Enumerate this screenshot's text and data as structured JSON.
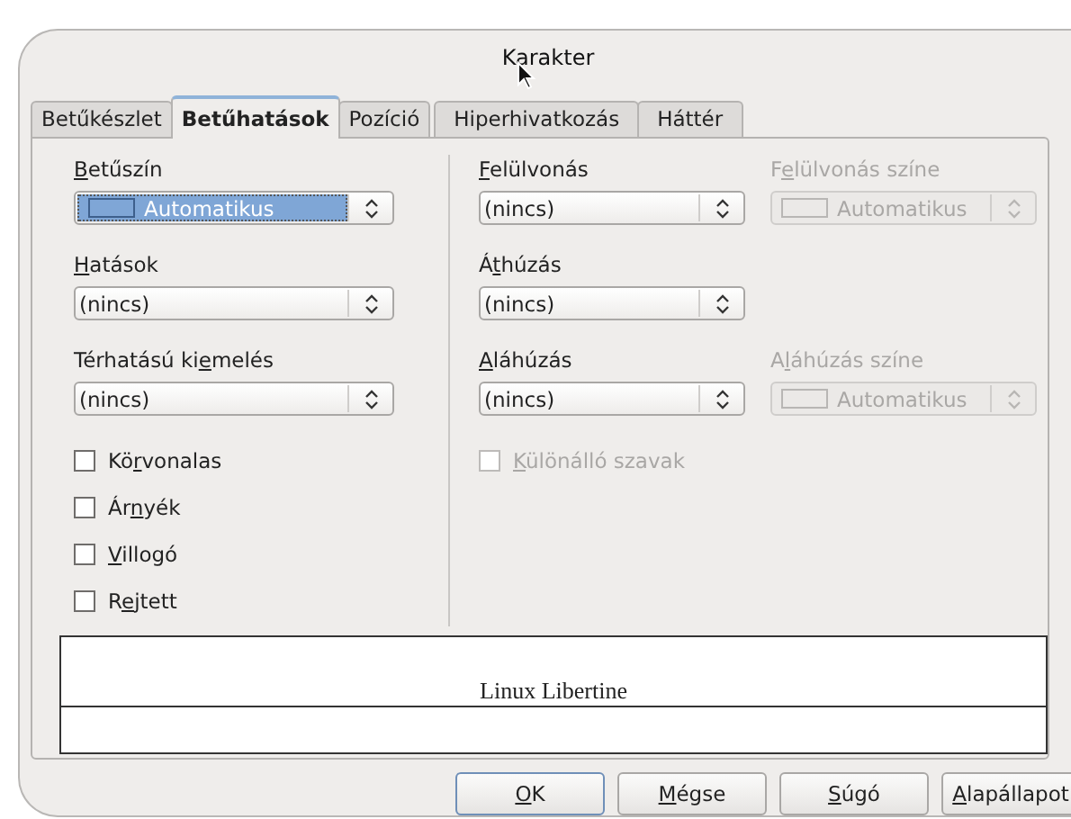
{
  "window": {
    "title": "Karakter"
  },
  "tabs": [
    {
      "label": "Betűkészlet",
      "selected": false
    },
    {
      "label": "Betűhatások",
      "selected": true
    },
    {
      "label": "Pozíció",
      "selected": false
    },
    {
      "label": "Hiperhivatkozás",
      "selected": false
    },
    {
      "label": "Háttér",
      "selected": false
    }
  ],
  "left_fields": [
    {
      "label": {
        "key": "B",
        "post": "etűszín"
      },
      "value": "Automatikus",
      "swatch": true,
      "highlighted": true,
      "disabled": false
    },
    {
      "label": {
        "key": "H",
        "post": "atások"
      },
      "value": "(nincs)",
      "swatch": false,
      "highlighted": false,
      "disabled": false
    },
    {
      "label": {
        "pre": "Térhatású ki",
        "key": "e",
        "post": "melés"
      },
      "value": "(nincs)",
      "swatch": false,
      "highlighted": false,
      "disabled": false
    }
  ],
  "left_checkboxes": [
    {
      "label": {
        "pre": "Kö",
        "key": "r",
        "post": "vonalas"
      },
      "checked": false,
      "disabled": false
    },
    {
      "label": {
        "pre": "Ár",
        "key": "n",
        "post": "yék"
      },
      "checked": false,
      "disabled": false
    },
    {
      "label": {
        "key": "V",
        "post": "illogó"
      },
      "checked": false,
      "disabled": false
    },
    {
      "label": {
        "pre": "R",
        "key": "e",
        "post": "jtett"
      },
      "checked": false,
      "disabled": false
    }
  ],
  "right_rows": [
    {
      "main": {
        "label": {
          "key": "F",
          "post": "elülvonás"
        },
        "value": "(nincs)",
        "swatch": false,
        "highlighted": false,
        "disabled": false
      },
      "color": {
        "label": {
          "pre": "F",
          "key": "e",
          "post": "lülvonás színe"
        },
        "value": "Automatikus",
        "swatch": true,
        "highlighted": false,
        "disabled": true
      }
    },
    {
      "main": {
        "label": {
          "pre": "Á",
          "key": "t",
          "post": "húzás"
        },
        "value": "(nincs)",
        "swatch": false,
        "highlighted": false,
        "disabled": false
      }
    },
    {
      "main": {
        "label": {
          "key": "A",
          "post": "láhúzás"
        },
        "value": "(nincs)",
        "swatch": false,
        "highlighted": false,
        "disabled": false
      },
      "color": {
        "label": {
          "pre": "A",
          "key": "l",
          "post": "áhúzás színe"
        },
        "value": "Automatikus",
        "swatch": true,
        "highlighted": false,
        "disabled": true
      }
    }
  ],
  "right_checkboxes": [
    {
      "label": {
        "key": "K",
        "post": "ülönálló szavak"
      },
      "checked": false,
      "disabled": true
    }
  ],
  "preview": {
    "text": "Linux Libertine"
  },
  "buttons": [
    {
      "label": {
        "key": "O",
        "post": "K"
      },
      "default": true
    },
    {
      "label": {
        "key": "M",
        "post": "égse"
      },
      "default": false
    },
    {
      "label": {
        "key": "S",
        "post": "úgó"
      },
      "default": false
    },
    {
      "label": {
        "key": "A",
        "post": "lapállapot"
      },
      "default": false
    }
  ]
}
